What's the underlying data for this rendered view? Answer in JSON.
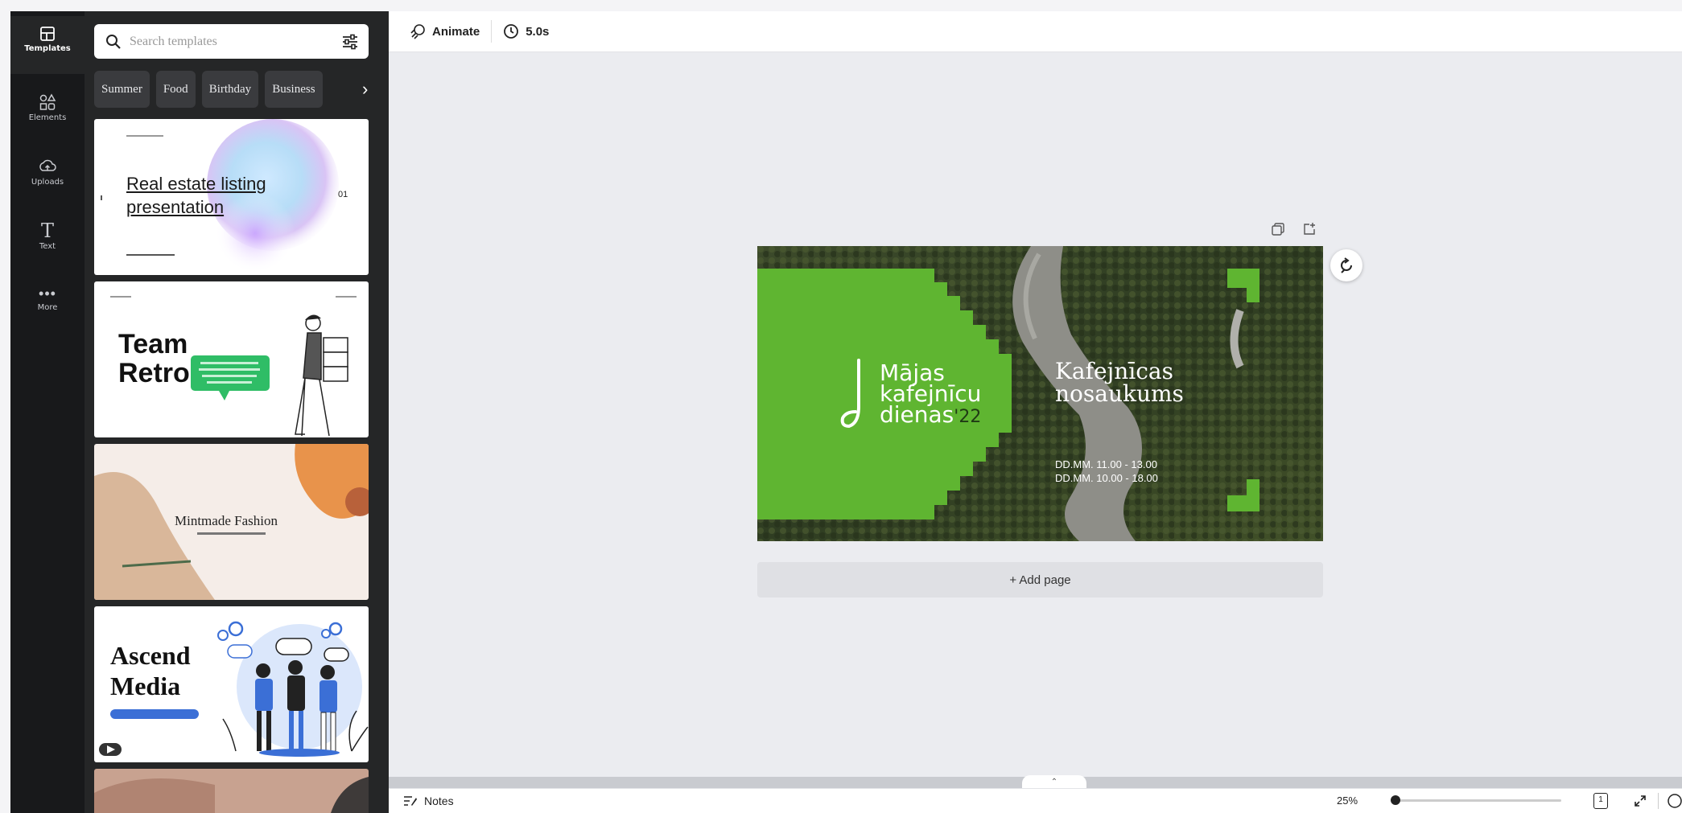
{
  "rail": {
    "items": [
      {
        "label": "Templates",
        "icon": "templates-icon"
      },
      {
        "label": "Elements",
        "icon": "elements-icon"
      },
      {
        "label": "Uploads",
        "icon": "upload-icon"
      },
      {
        "label": "Text",
        "icon": "text-icon"
      },
      {
        "label": "More",
        "icon": "more-icon"
      }
    ]
  },
  "panel": {
    "search_placeholder": "Search templates",
    "chips": [
      "Summer",
      "Food",
      "Birthday",
      "Business"
    ],
    "templates": [
      {
        "title": "Real estate listing presentation",
        "page_number": "01"
      },
      {
        "title_line1": "Team",
        "title_line2": "Retro"
      },
      {
        "title": "Mintmade Fashion"
      },
      {
        "title_line1": "Ascend",
        "title_line2": "Media"
      }
    ]
  },
  "toolbar": {
    "animate_label": "Animate",
    "duration_label": "5.0s"
  },
  "slide": {
    "brand_line1": "Mājas",
    "brand_line2": "kafejnīcu",
    "brand_line3": "dienas",
    "brand_year": "'22",
    "cafe_line1": "Kafejnīcas",
    "cafe_line2": "nosaukums",
    "hours_line1": "DD.MM. 11.00 - 13.00",
    "hours_line2": "DD.MM. 10.00 - 18.00",
    "accent_green": "#5fb531"
  },
  "canvas": {
    "add_page_label": "+ Add page"
  },
  "bottombar": {
    "notes_label": "Notes",
    "zoom_label": "25%",
    "zoom_level": 25,
    "page_count": "1"
  }
}
